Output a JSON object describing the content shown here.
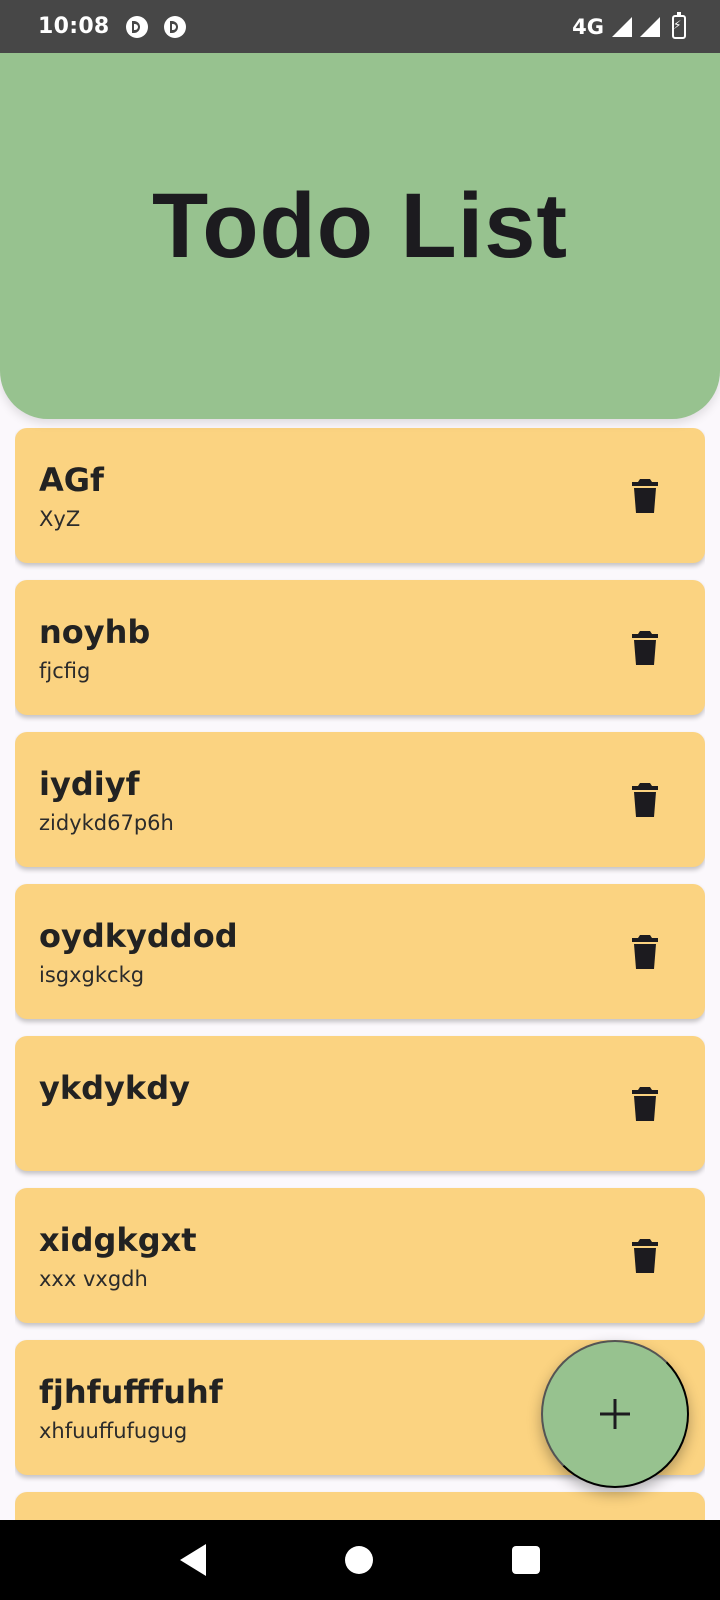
{
  "status_bar": {
    "time": "10:08",
    "network": "4G",
    "icons": [
      "notification-icon",
      "notification-icon",
      "signal-icon",
      "signal-icon",
      "battery-charging-icon"
    ]
  },
  "header": {
    "title": "Todo List",
    "background_color": "#97c28f"
  },
  "todos": [
    {
      "title": "AGf",
      "description": "XyZ"
    },
    {
      "title": "noyhb",
      "description": "fjcfig"
    },
    {
      "title": "iydiyf",
      "description": "zidykd67p6h"
    },
    {
      "title": "oydkyddod",
      "description": "isgxgkckg"
    },
    {
      "title": "ykdykdy",
      "description": ""
    },
    {
      "title": "xidgkgxt",
      "description": "xxx vxgdh"
    },
    {
      "title": "fjhfufffuhf",
      "description": "xhfuuffufugug"
    },
    {
      "title": "",
      "description": ""
    }
  ],
  "card_color": "#fbd381",
  "item_action_icon": "trash-icon",
  "fab": {
    "icon": "plus-icon",
    "color": "#97c28f"
  },
  "nav_bar": {
    "icons": [
      "back-icon",
      "home-icon",
      "recents-icon"
    ]
  }
}
